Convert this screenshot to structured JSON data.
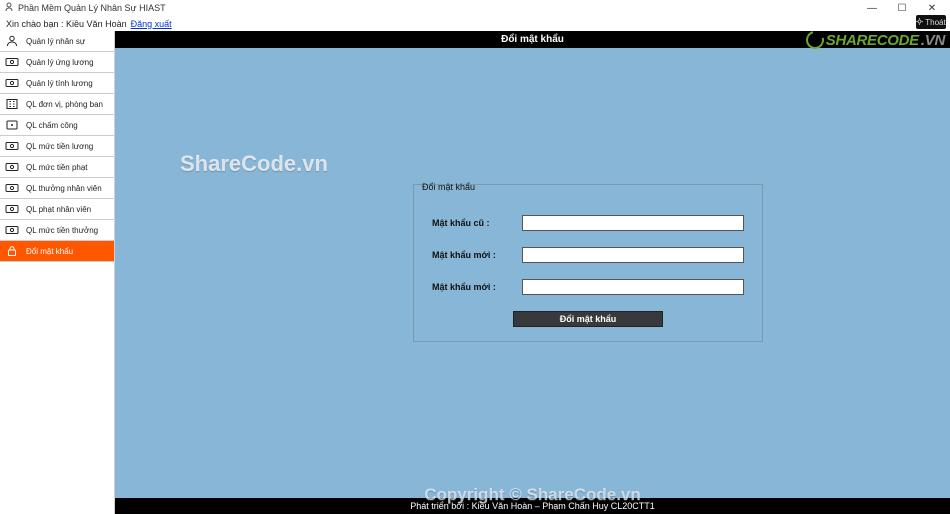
{
  "window": {
    "title": "Phần Mềm Quản Lý Nhân Sự HIAST"
  },
  "welcome": {
    "greeting": "Xin chào bạn : Kiều Văn Hoàn",
    "logout": "Đăng xuất",
    "settings_label": "Thoát"
  },
  "header": {
    "title": "Đổi mật khẩu"
  },
  "sidebar": {
    "items": [
      {
        "label": "Quản lý nhân sự",
        "icon": "user"
      },
      {
        "label": "Quản lý ứng lương",
        "icon": "money"
      },
      {
        "label": "Quản lý tính lương",
        "icon": "money"
      },
      {
        "label": "QL đơn vị, phòng ban",
        "icon": "building"
      },
      {
        "label": "QL chấm công",
        "icon": "clock"
      },
      {
        "label": "QL mức tiền lương",
        "icon": "money"
      },
      {
        "label": "QL mức tiền phạt",
        "icon": "money"
      },
      {
        "label": "QL thưởng nhân viên",
        "icon": "money"
      },
      {
        "label": "QL phạt nhân viên",
        "icon": "money"
      },
      {
        "label": "QL mức tiền thưởng",
        "icon": "money"
      },
      {
        "label": "Đổi mật khẩu",
        "icon": "lock"
      }
    ],
    "active_index": 10
  },
  "form": {
    "title": "Đổi mật khẩu",
    "old_password_label": "Mật khẩu cũ :",
    "new_password_label": "Mật khẩu mới :",
    "confirm_password_label": "Mật khẩu mới :",
    "submit_label": "Đổi mật khẩu",
    "old_password_value": "",
    "new_password_value": "",
    "confirm_password_value": ""
  },
  "footer": {
    "text": "Phát triển bởi : Kiều Văn Hoàn – Phạm Chấn Huy CL20CTT1"
  },
  "watermarks": {
    "w1": "ShareCode.vn",
    "w2": "Copyright © ShareCode.vn",
    "badge_main": "SHARECODE",
    "badge_suffix": ".VN"
  }
}
